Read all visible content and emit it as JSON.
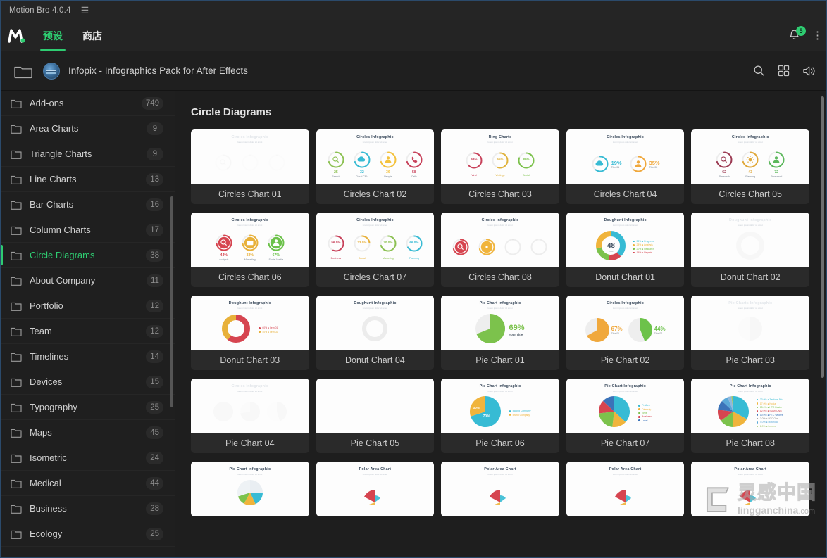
{
  "window": {
    "app_title": "Motion Bro 4.0.4",
    "menu_icon": "hamburger-icon"
  },
  "topnav": {
    "logo": "motion-bro-logo",
    "tabs": [
      {
        "label": "预设",
        "active": true
      },
      {
        "label": "商店",
        "active": false
      }
    ],
    "notification_count": "5",
    "bell_icon": "bell-icon",
    "more_icon": "kebab-menu-icon"
  },
  "breadcrumb": {
    "folder_icon": "folder-icon",
    "pack_thumb": "pack-thumbnail",
    "title": "Infopix - Infographics Pack for After Effects",
    "actions": [
      {
        "name": "search-icon"
      },
      {
        "name": "grid-view-icon"
      },
      {
        "name": "sound-icon"
      }
    ]
  },
  "sidebar": {
    "items": [
      {
        "label": "Add-ons",
        "count": "749",
        "active": false
      },
      {
        "label": "Area Charts",
        "count": "9",
        "active": false
      },
      {
        "label": "Triangle Charts",
        "count": "9",
        "active": false
      },
      {
        "label": "Line Charts",
        "count": "13",
        "active": false
      },
      {
        "label": "Bar Charts",
        "count": "16",
        "active": false
      },
      {
        "label": "Column Charts",
        "count": "17",
        "active": false
      },
      {
        "label": "Circle Diagrams",
        "count": "38",
        "active": true
      },
      {
        "label": "About Company",
        "count": "11",
        "active": false
      },
      {
        "label": "Portfolio",
        "count": "12",
        "active": false
      },
      {
        "label": "Team",
        "count": "12",
        "active": false
      },
      {
        "label": "Timelines",
        "count": "14",
        "active": false
      },
      {
        "label": "Devices",
        "count": "15",
        "active": false
      },
      {
        "label": "Typography",
        "count": "25",
        "active": false
      },
      {
        "label": "Maps",
        "count": "45",
        "active": false
      },
      {
        "label": "Isometric",
        "count": "24",
        "active": false
      },
      {
        "label": "Medical",
        "count": "44",
        "active": false
      },
      {
        "label": "Business",
        "count": "28",
        "active": false
      },
      {
        "label": "Ecology",
        "count": "25",
        "active": false
      }
    ]
  },
  "main": {
    "section_title": "Circle Diagrams",
    "items": [
      {
        "label": "Circles Chart 01",
        "thumb_title": "Circles Infographic",
        "style": "faded-circles"
      },
      {
        "label": "Circles Chart 02",
        "thumb_title": "Circles Infographic",
        "style": "rings-icons-4",
        "rings": [
          {
            "value": "25",
            "caption": "Search",
            "color": "#8cc152",
            "icon": "search-icon"
          },
          {
            "value": "32",
            "caption": "Cloud CRV",
            "color": "#37bbd4",
            "icon": "cloud-icon"
          },
          {
            "value": "36",
            "caption": "People",
            "color": "#f4c23c",
            "icon": "person-icon"
          },
          {
            "value": "58",
            "caption": "Calls",
            "color": "#c8415a",
            "icon": "phone-icon"
          }
        ]
      },
      {
        "label": "Circles Chart 03",
        "thumb_title": "Ring Charts",
        "style": "rings-pct-3",
        "rings": [
          {
            "value": "63%",
            "caption": "Viral",
            "color": "#c8415a"
          },
          {
            "value": "55%",
            "caption": "Writings",
            "color": "#e0b23a"
          },
          {
            "value": "80%",
            "caption": "Social",
            "color": "#7cc24c"
          }
        ]
      },
      {
        "label": "Circles Chart 04",
        "thumb_title": "Circles Infographic",
        "style": "pct-pairs-2",
        "rings": [
          {
            "value": "19%",
            "caption": "Title 01",
            "color": "#37bbd4",
            "icon": "cloud-icon"
          },
          {
            "value": "35%",
            "caption": "Title 02",
            "color": "#f0a83c",
            "icon": "person-icon"
          }
        ]
      },
      {
        "label": "Circles Chart 05",
        "thumb_title": "Circles Infographic",
        "style": "rings-icons-3",
        "rings": [
          {
            "value": "62",
            "caption": "Research",
            "color": "#9c3a52",
            "icon": "search-icon"
          },
          {
            "value": "43",
            "caption": "Planning",
            "color": "#e0a83a",
            "icon": "gear-icon"
          },
          {
            "value": "72",
            "caption": "Personnel",
            "color": "#5cb85c",
            "icon": "person-icon"
          }
        ]
      },
      {
        "label": "Circles Chart 06",
        "thumb_title": "Circles Infographic",
        "style": "filled-icons-3",
        "rings": [
          {
            "value": "44%",
            "caption": "Analysis",
            "color": "#d64550",
            "icon": "search-icon"
          },
          {
            "value": "33%",
            "caption": "Marketing",
            "color": "#e8b13a",
            "icon": "mail-icon"
          },
          {
            "value": "67%",
            "caption": "Social Media",
            "color": "#6cc24a",
            "icon": "person-icon"
          }
        ]
      },
      {
        "label": "Circles Chart 07",
        "thumb_title": "Circles Infographic",
        "style": "rings-pct-4",
        "rings": [
          {
            "value": "56.0%",
            "caption": "Business",
            "color": "#c8415a"
          },
          {
            "value": "23.0%",
            "caption": "Social",
            "color": "#e8b13a"
          },
          {
            "value": "70.0%",
            "caption": "Marketing",
            "color": "#8cc152"
          },
          {
            "value": "66.0%",
            "caption": "Planning",
            "color": "#37bbd4"
          }
        ]
      },
      {
        "label": "Circles Chart 08",
        "thumb_title": "Circles Infographic",
        "style": "dots-fade-4",
        "rings": [
          {
            "color": "#d64550",
            "icon": "search-icon"
          },
          {
            "color": "#f0b43c",
            "icon": "dot-icon"
          },
          {
            "color": "#e6e6e6",
            "icon": "blank-icon"
          },
          {
            "color": "#f2f2f2",
            "icon": "blank-icon"
          }
        ]
      },
      {
        "label": "Donut Chart 01",
        "thumb_title": "Doughunt Infographic",
        "style": "donut-center",
        "center_value": "48",
        "center_caption": "Total",
        "legend": [
          {
            "label": "38% ● Progress",
            "color": "#37bbd4"
          },
          {
            "label": "28% ● Analysis",
            "color": "#f0b43c"
          },
          {
            "label": "20% ● Research",
            "color": "#7cc24c"
          },
          {
            "label": "14% ● Reports",
            "color": "#d64550"
          }
        ]
      },
      {
        "label": "Donut Chart 02",
        "thumb_title": "Doughunt Infographic",
        "style": "faded-donut"
      },
      {
        "label": "Donut Chart 03",
        "thumb_title": "Doughunt Infographic",
        "style": "donut-legend",
        "legend": [
          {
            "label": "60% ● Item 01",
            "color": "#d64550"
          },
          {
            "label": "40% ● Item 02",
            "color": "#e8b13a"
          }
        ]
      },
      {
        "label": "Donut Chart 04",
        "thumb_title": "Doughunt Infographic",
        "style": "empty-donut"
      },
      {
        "label": "Pie Chart 01",
        "thumb_title": "Pie Chart Infographic",
        "style": "pie-big",
        "big_value": "69%",
        "big_caption": "Your Title",
        "color": "#7cc24c"
      },
      {
        "label": "Pie Chart 02",
        "thumb_title": "Circles Infographic",
        "style": "pie-pair",
        "pies": [
          {
            "value": "67%",
            "caption": "Title 01",
            "color": "#f0a83c"
          },
          {
            "value": "44%",
            "caption": "Title 02",
            "color": "#6cc24a"
          }
        ]
      },
      {
        "label": "Pie Chart 03",
        "thumb_title": "Pie Charts Infographic",
        "style": "faded-pie"
      },
      {
        "label": "Pie Chart 04",
        "thumb_title": "Circles Infographic",
        "style": "faded-shapes"
      },
      {
        "label": "Pie Chart 05",
        "thumb_title": "",
        "style": "blank"
      },
      {
        "label": "Pie Chart 06",
        "thumb_title": "Pie Chart Infographic",
        "style": "pie-two-legend",
        "slices": [
          {
            "value": "70%",
            "color": "#37bbd4"
          },
          {
            "value": "30%",
            "color": "#f0b43c"
          }
        ],
        "legend": [
          {
            "label": "Baking Company",
            "color": "#37bbd4"
          },
          {
            "label": "Brand Company",
            "color": "#f0b43c"
          }
        ]
      },
      {
        "label": "Pie Chart 07",
        "thumb_title": "Pie Chart Infographic",
        "style": "pie-five-legend",
        "slices": [
          {
            "value": "36.9%",
            "color": "#37bbd4"
          },
          {
            "value": "15.2%",
            "color": "#f0b43c"
          },
          {
            "value": "21.2%",
            "color": "#7cc24c"
          },
          {
            "value": "13.8%",
            "color": "#d64550"
          },
          {
            "value": "13.0%",
            "color": "#3b73b9"
          }
        ],
        "legend": [
          {
            "label": "Profiles",
            "color": "#37bbd4"
          },
          {
            "label": "Diversity",
            "color": "#f0b43c"
          },
          {
            "label": "Style",
            "color": "#7cc24c"
          },
          {
            "label": "Analyses",
            "color": "#d64550"
          },
          {
            "label": "Level",
            "color": "#3b73b9"
          }
        ]
      },
      {
        "label": "Pie Chart 08",
        "thumb_title": "Pie Chart Infographic",
        "style": "pie-seven-legend",
        "legend": [
          {
            "label": "33.0% ● Zenfone 5th",
            "color": "#37bbd4"
          },
          {
            "label": "17.0% ● Nokia",
            "color": "#f0b43c"
          },
          {
            "label": "15.0% ● HTC Desire",
            "color": "#7cc24c"
          },
          {
            "label": "12.0% ● SUMSUNG",
            "color": "#d64550"
          },
          {
            "label": "10.0% ● HTC Wildfire",
            "color": "#3b73b9"
          },
          {
            "label": "7.0% ● HTC One",
            "color": "#8a8a8a"
          },
          {
            "label": "4.0% ● Motorola",
            "color": "#5aa8d8"
          },
          {
            "label": "2.0% ● Lenovo",
            "color": "#a0c46c"
          }
        ]
      },
      {
        "label": "",
        "thumb_title": "Pie Chart Infographic",
        "style": "row-pie-partial"
      },
      {
        "label": "",
        "thumb_title": "Polar Area Chart",
        "style": "row-polar-partial"
      },
      {
        "label": "",
        "thumb_title": "Polar Area Chart",
        "style": "row-polar-partial"
      },
      {
        "label": "",
        "thumb_title": "Polar Area Chart",
        "style": "row-polar-partial"
      },
      {
        "label": "",
        "thumb_title": "Polar Area Chart",
        "style": "row-polar-partial"
      }
    ]
  },
  "watermark": {
    "logo": "lingganchina-logo",
    "chinese": "灵感中国",
    "domain_main": "lingganchina",
    "domain_tld": ".com"
  }
}
